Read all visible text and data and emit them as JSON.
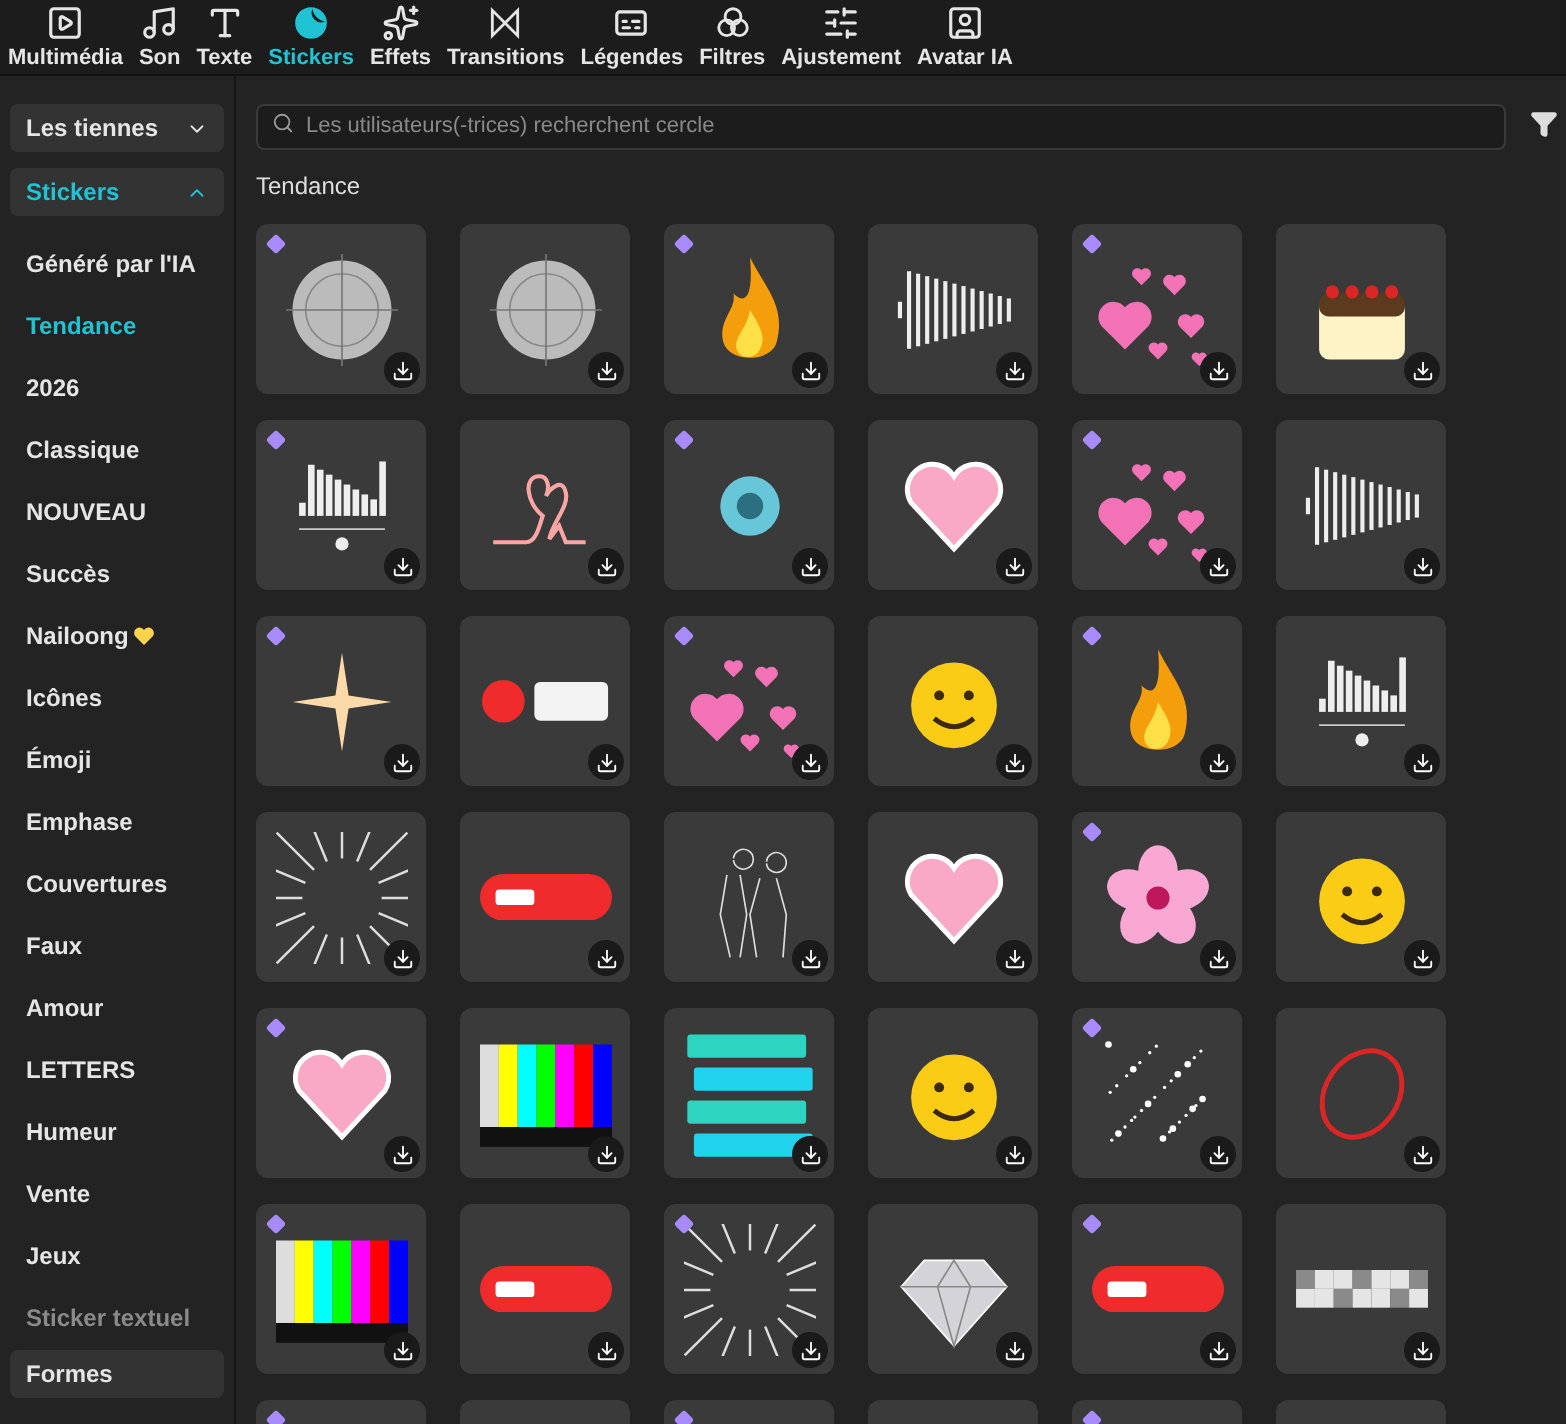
{
  "tabs": [
    {
      "label": "Multimédia",
      "selected": false
    },
    {
      "label": "Son",
      "selected": false
    },
    {
      "label": "Texte",
      "selected": false
    },
    {
      "label": "Stickers",
      "selected": true
    },
    {
      "label": "Effets",
      "selected": false
    },
    {
      "label": "Transitions",
      "selected": false
    },
    {
      "label": "Légendes",
      "selected": false
    },
    {
      "label": "Filtres",
      "selected": false
    },
    {
      "label": "Ajustement",
      "selected": false
    },
    {
      "label": "Avatar IA",
      "selected": false
    }
  ],
  "sidebar": {
    "groups": [
      {
        "label": "Les tiennes",
        "expanded": false,
        "selected": false
      },
      {
        "label": "Stickers",
        "expanded": true,
        "selected": true
      }
    ],
    "items": [
      {
        "label": "Généré par l'IA",
        "selected": false
      },
      {
        "label": "Tendance",
        "selected": true
      },
      {
        "label": "2026",
        "selected": false
      },
      {
        "label": "Classique",
        "selected": false
      },
      {
        "label": "NOUVEAU",
        "selected": false
      },
      {
        "label": "Succès",
        "selected": false
      },
      {
        "label": "Nailoong",
        "selected": false,
        "heart": true
      },
      {
        "label": "Icônes",
        "selected": false
      },
      {
        "label": "Émoji",
        "selected": false
      },
      {
        "label": "Emphase",
        "selected": false
      },
      {
        "label": "Couvertures",
        "selected": false
      },
      {
        "label": "Faux",
        "selected": false
      },
      {
        "label": "Amour",
        "selected": false
      },
      {
        "label": "LETTERS",
        "selected": false
      },
      {
        "label": "Humeur",
        "selected": false
      },
      {
        "label": "Vente",
        "selected": false
      },
      {
        "label": "Jeux",
        "selected": false
      },
      {
        "label": "Sticker textuel",
        "selected": false,
        "faded": true
      }
    ],
    "footer": {
      "label": "Formes"
    }
  },
  "search": {
    "placeholder": "Les utilisateurs(-trices) recherchent cercle"
  },
  "section": {
    "title": "Tendance"
  },
  "stickers": [
    {
      "kind": "dial",
      "premium": true
    },
    {
      "kind": "dial",
      "premium": false
    },
    {
      "kind": "flame",
      "premium": true
    },
    {
      "kind": "wave",
      "premium": false
    },
    {
      "kind": "hearts",
      "premium": true
    },
    {
      "kind": "cake",
      "premium": false
    },
    {
      "kind": "eq",
      "premium": true
    },
    {
      "kind": "neon",
      "premium": false
    },
    {
      "kind": "burst",
      "premium": true
    },
    {
      "kind": "heart",
      "premium": false
    },
    {
      "kind": "hearts",
      "premium": true
    },
    {
      "kind": "wave",
      "premium": false
    },
    {
      "kind": "star",
      "premium": true
    },
    {
      "kind": "rec",
      "premium": false
    },
    {
      "kind": "hearts",
      "premium": true
    },
    {
      "kind": "face",
      "premium": false
    },
    {
      "kind": "flame",
      "premium": true
    },
    {
      "kind": "eq",
      "premium": false
    },
    {
      "kind": "lines",
      "premium": false
    },
    {
      "kind": "pill",
      "premium": false
    },
    {
      "kind": "sketch",
      "premium": false
    },
    {
      "kind": "heart",
      "premium": false
    },
    {
      "kind": "flower",
      "premium": true
    },
    {
      "kind": "face",
      "premium": false
    },
    {
      "kind": "heart",
      "premium": true
    },
    {
      "kind": "colorbars",
      "premium": false
    },
    {
      "kind": "stack",
      "premium": false
    },
    {
      "kind": "face",
      "premium": false
    },
    {
      "kind": "glitter",
      "premium": true
    },
    {
      "kind": "ring",
      "premium": false
    },
    {
      "kind": "colorbars",
      "premium": true
    },
    {
      "kind": "pill",
      "premium": false
    },
    {
      "kind": "lines",
      "premium": true
    },
    {
      "kind": "gem",
      "premium": false
    },
    {
      "kind": "pill",
      "premium": true
    },
    {
      "kind": "pixels",
      "premium": false
    },
    {
      "kind": "blank",
      "premium": true
    },
    {
      "kind": "blank",
      "premium": false
    },
    {
      "kind": "blank",
      "premium": true
    },
    {
      "kind": "blank",
      "premium": false
    },
    {
      "kind": "blank",
      "premium": true
    },
    {
      "kind": "blank",
      "premium": false
    }
  ]
}
